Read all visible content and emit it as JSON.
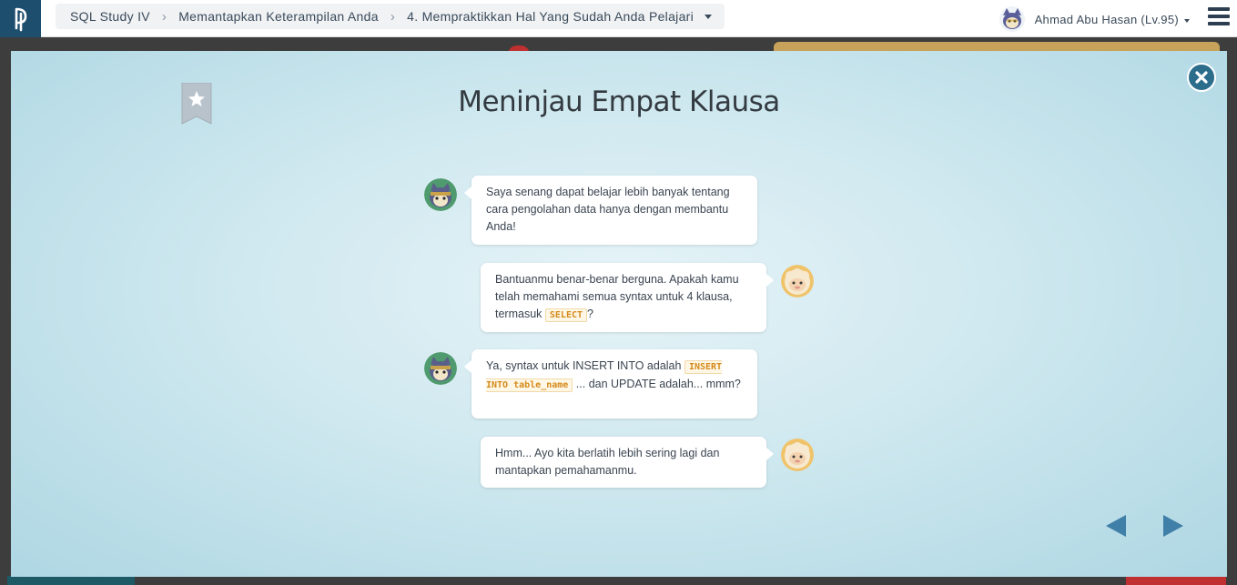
{
  "topbar": {
    "breadcrumb": [
      "SQL Study IV",
      "Memantapkan Keterampilan Anda",
      "4. Mempraktikkan Hal Yang Sudah Anda Pelajari"
    ],
    "user_name": "Ahmad Abu Hasan (Lv.95)"
  },
  "modal": {
    "title": "Meninjau Empat Klausa"
  },
  "chat": {
    "m1": "Saya senang dapat belajar lebih banyak tentang cara pengolahan data hanya dengan membantu Anda!",
    "m2_text": "Bantuanmu benar-benar berguna. Apakah kamu telah memahami semua syntax untuk 4 klausa, termasuk",
    "m2_code": "SELECT",
    "m2_end": "?",
    "m3_text": "Ya, syntax untuk INSERT INTO adalah",
    "m3_code": "INSERT INTO table_name",
    "m3_end": "... dan UPDATE adalah... mmm?",
    "m4": "Hmm... Ayo kita berlatih lebih sering lagi dan mantapkan pemahamanmu."
  },
  "icons": {
    "logo": "progate-logo-icon",
    "bookmark": "bookmark-star-icon",
    "close": "close-icon",
    "prev": "arrow-left-icon",
    "next": "arrow-right-icon",
    "menu": "hamburger-menu-icon"
  },
  "colors": {
    "accent": "#2d6d8c",
    "code": "#d48a1a"
  }
}
